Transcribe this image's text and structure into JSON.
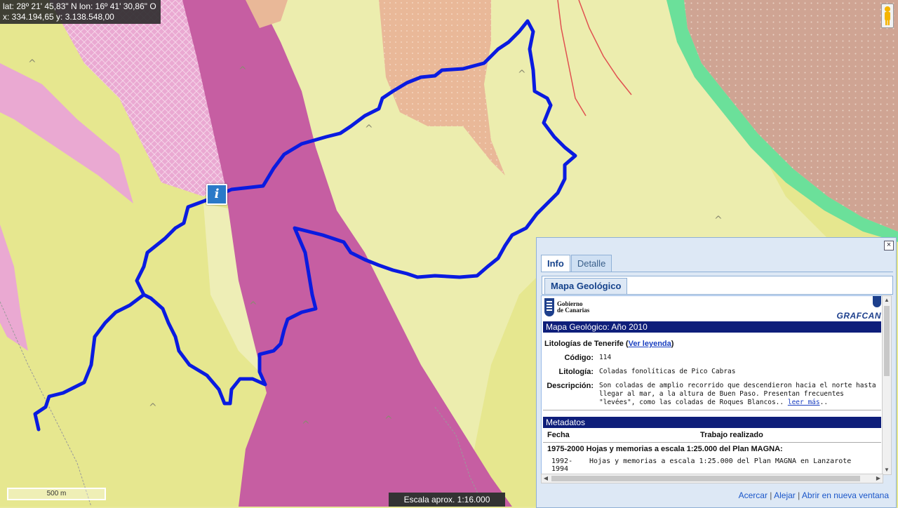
{
  "map": {
    "coords_line1": "lat: 28º 21' 45,83\" N  lon: 16º 41' 30,86\" O",
    "coords_line2": "x: 334.194,65  y: 3.138.548,00",
    "scalebar_label": "500 m",
    "scale_text": "Escala aprox. 1:16.000",
    "info_marker": "i",
    "colors": {
      "route": "#0a1be0",
      "yellow": "#e9ea93",
      "magenta": "#c65ea2",
      "pink": "#eaa9d2",
      "salmon": "#e9b898",
      "brown": "#cfa493",
      "green": "#6be09a",
      "fault": "#e05050"
    }
  },
  "panel": {
    "close": "×",
    "tabs": [
      {
        "label": "Info",
        "active": true
      },
      {
        "label": "Detalle",
        "active": false
      }
    ],
    "subtab": "Mapa Geológico",
    "logo_left_line1": "Gobierno",
    "logo_left_line2": "de Canarias",
    "logo_right": "GRAFCAN",
    "header": "Mapa Geológico: Año 2010",
    "lit_title": "Litologías de Tenerife",
    "lit_link": "Ver leyenda",
    "codigo_key": "Código:",
    "codigo_val": "114",
    "litologia_key": "Litología:",
    "litologia_val": "Coladas fonolíticas de Pico Cabras",
    "descripcion_key": "Descripción:",
    "descripcion_val": "Son coladas de amplio recorrido que descendieron hacia el norte hasta llegar al mar, a la altura de Buen Paso. Presentan frecuentes \"levées\", como las coladas de Roques Blancos..",
    "leer_mas": "leer más",
    "leer_mas_suffix": "..",
    "metadatos": "Metadatos",
    "meta_col1": "Fecha",
    "meta_col2": "Trabajo realizado",
    "meta_group": "1975-2000 Hojas y memorias a escala 1:25.000 del Plan MAGNA:",
    "meta_row_date": "1992-\n1994",
    "meta_row_text": "Hojas y memorias a escala 1:25.000 del Plan MAGNA en Lanzarote",
    "links": [
      "Acercar",
      "Alejar",
      "Abrir en nueva ventana"
    ]
  }
}
